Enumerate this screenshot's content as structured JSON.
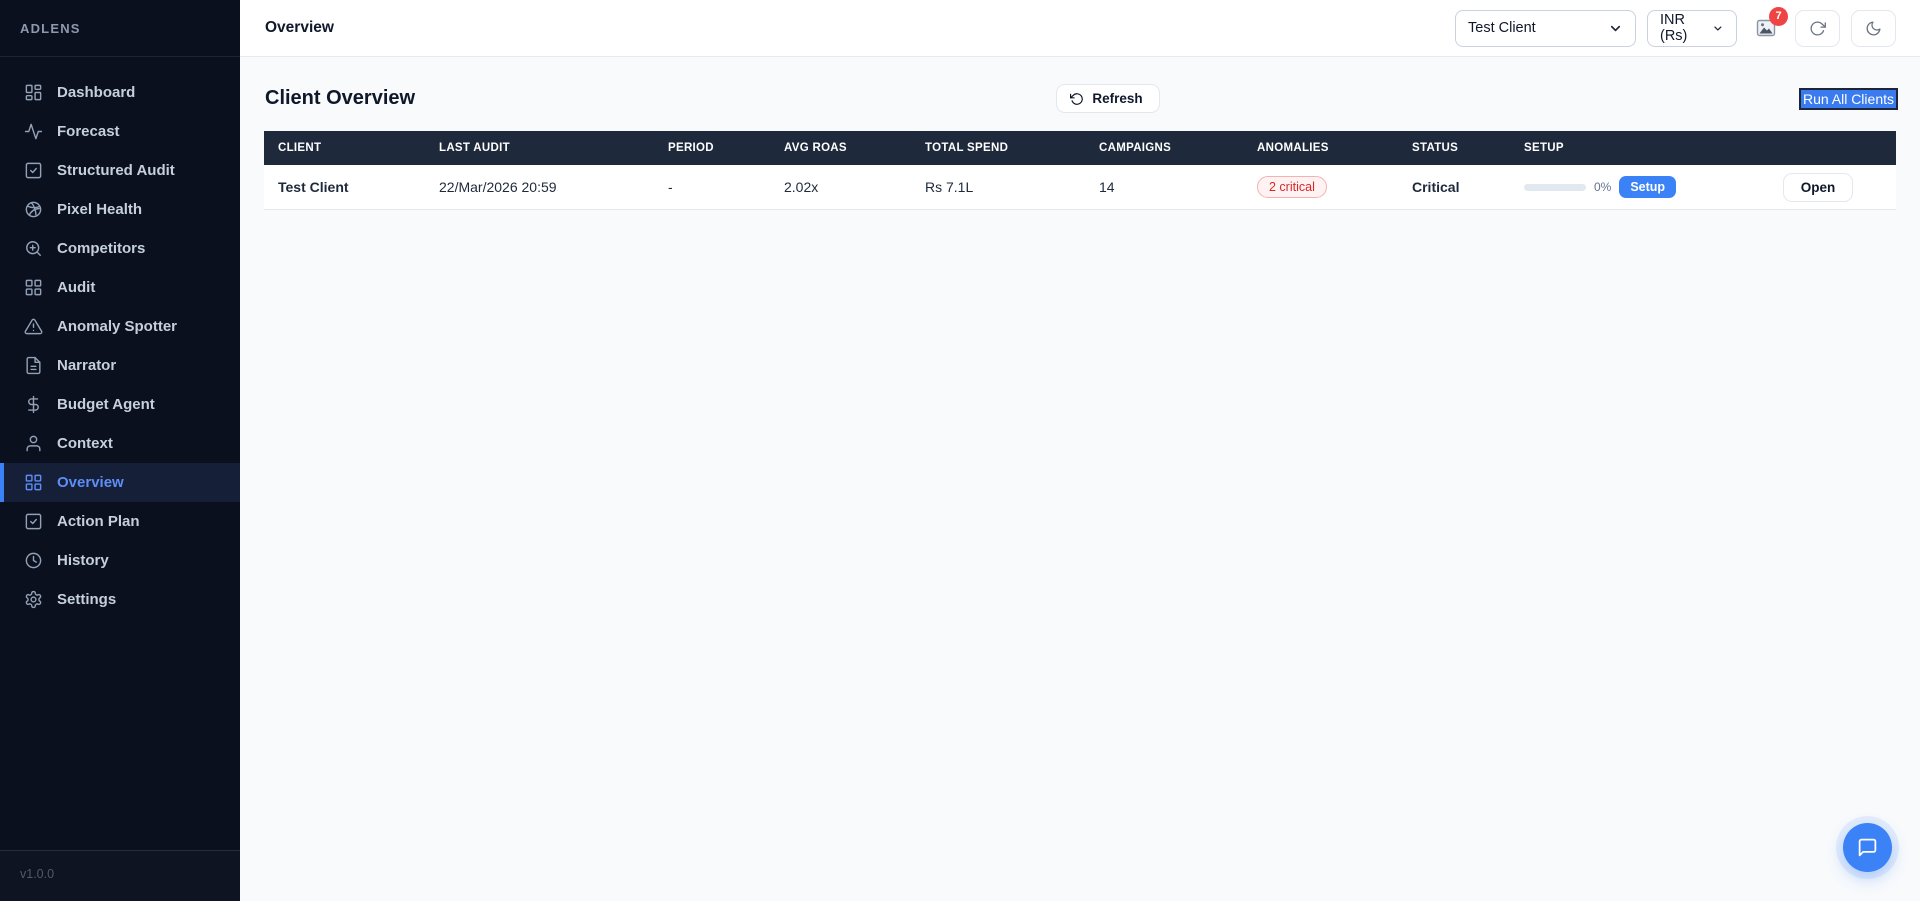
{
  "app": {
    "brand": "ADLENS",
    "version": "v1.0.0"
  },
  "topbar": {
    "title": "Overview",
    "client_select": {
      "value": "Test Client"
    },
    "currency_select": {
      "value": "INR (Rs)"
    },
    "notification_count": "7",
    "icons": [
      "broken-image-icon",
      "refresh-cw-icon",
      "moon-icon"
    ]
  },
  "sidebar": {
    "items": [
      {
        "label": "Dashboard",
        "icon": "dashboard-icon"
      },
      {
        "label": "Forecast",
        "icon": "activity-icon"
      },
      {
        "label": "Structured Audit",
        "icon": "square-check-icon"
      },
      {
        "label": "Pixel Health",
        "icon": "dribbble-icon"
      },
      {
        "label": "Competitors",
        "icon": "zoom-in-icon"
      },
      {
        "label": "Audit",
        "icon": "grid-icon"
      },
      {
        "label": "Anomaly Spotter",
        "icon": "alert-triangle-icon"
      },
      {
        "label": "Narrator",
        "icon": "file-text-icon"
      },
      {
        "label": "Budget Agent",
        "icon": "dollar-icon"
      },
      {
        "label": "Context",
        "icon": "user-icon"
      },
      {
        "label": "Overview",
        "icon": "overview-grid-icon",
        "active": true
      },
      {
        "label": "Action Plan",
        "icon": "square-check-icon"
      },
      {
        "label": "History",
        "icon": "clock-icon"
      },
      {
        "label": "Settings",
        "icon": "gear-icon"
      }
    ]
  },
  "main": {
    "section_title": "Client Overview",
    "refresh_label": "Refresh",
    "run_all_label": "Run All Clients",
    "table": {
      "columns": [
        "CLIENT",
        "LAST AUDIT",
        "PERIOD",
        "AVG ROAS",
        "TOTAL SPEND",
        "CAMPAIGNS",
        "ANOMALIES",
        "STATUS",
        "SETUP",
        ""
      ],
      "rows": [
        {
          "client": "Test Client",
          "last_audit": "22/Mar/2026 20:59",
          "period": "-",
          "avg_roas": "2.02x",
          "total_spend": "Rs 7.1L",
          "campaigns": "14",
          "anomalies_badge": "2 critical",
          "status": "Critical",
          "setup_percent": "0%",
          "setup_button": "Setup",
          "open_button": "Open"
        }
      ]
    }
  },
  "colors": {
    "sidebar_bg": "#0a101e",
    "accent_blue": "#3b82f6",
    "table_header_bg": "#1e293b",
    "critical_red": "#dc2626",
    "badge_red": "#ef4444",
    "content_bg": "#f8fafc"
  }
}
